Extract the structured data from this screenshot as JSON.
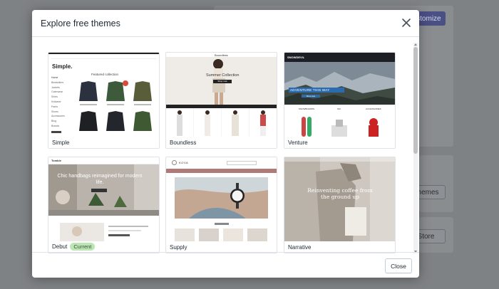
{
  "background": {
    "customize_label": "Customize",
    "themes_label": "Themes",
    "store_label": "Store"
  },
  "modal": {
    "title": "Explore free themes",
    "close_label": "Close",
    "themes": [
      {
        "name": "Simple",
        "current": false
      },
      {
        "name": "Boundless",
        "current": false
      },
      {
        "name": "Venture",
        "current": false
      },
      {
        "name": "Debut",
        "current": true
      },
      {
        "name": "Supply",
        "current": false
      },
      {
        "name": "Narrative",
        "current": false
      }
    ],
    "current_badge": "Current"
  },
  "previews": {
    "simple": {
      "logo": "Simple.",
      "heading": "Featured collection",
      "menu": [
        "Home",
        "Bestsellers",
        "Jackets",
        "Outerwear",
        "Shirts",
        "Knitwear",
        "Pants",
        "Shoes",
        "Accessories",
        "Blog",
        "Brands"
      ]
    },
    "boundless": {
      "brand": "Boundless",
      "heading": "Summer Collection",
      "cta": "Shop now"
    },
    "venture": {
      "brand": "SNOWDEVIL",
      "hero": "ADVENTURE THIS WAY",
      "cta": "Shop now",
      "cats": [
        "SNOWBOARDS",
        "SKI",
        "ACCESSORIES"
      ]
    },
    "debut": {
      "brand": "Tumble",
      "hero": "Chic handbags reimagined for modern life."
    },
    "supply": {
      "brand": "KOVA"
    },
    "narrative": {
      "hero": "Reinventing coffee from the ground up"
    }
  },
  "colors": {
    "primary": "#4a4f84",
    "badge_bg": "#bbe5b3",
    "venture_blue": "#2b6cb0"
  }
}
